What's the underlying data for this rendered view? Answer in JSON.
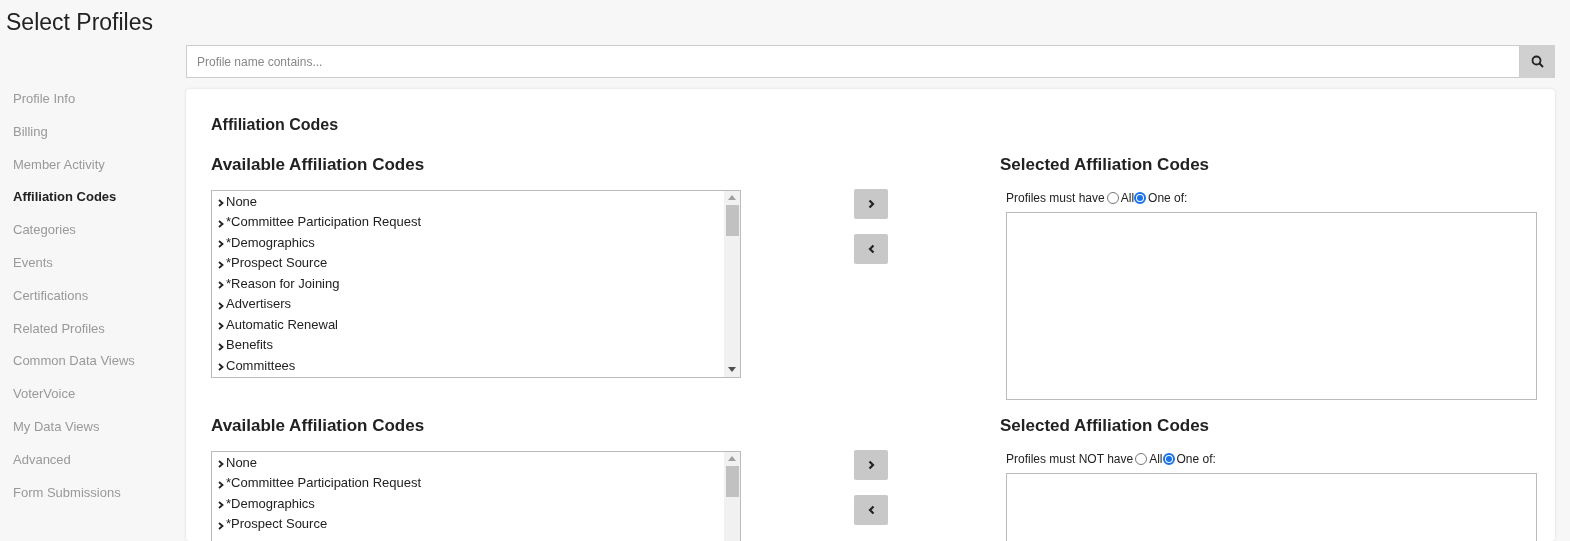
{
  "page_title": "Select Profiles",
  "search": {
    "placeholder": "Profile name contains..."
  },
  "sidebar": {
    "items": [
      {
        "label": "Profile Info",
        "selected": false
      },
      {
        "label": "Billing",
        "selected": false
      },
      {
        "label": "Member Activity",
        "selected": false
      },
      {
        "label": "Affiliation Codes",
        "selected": true
      },
      {
        "label": "Categories",
        "selected": false
      },
      {
        "label": "Events",
        "selected": false
      },
      {
        "label": "Certifications",
        "selected": false
      },
      {
        "label": "Related Profiles",
        "selected": false
      },
      {
        "label": "Common Data Views",
        "selected": false
      },
      {
        "label": "VoterVoice",
        "selected": false
      },
      {
        "label": "My Data Views",
        "selected": false
      },
      {
        "label": "Advanced",
        "selected": false
      },
      {
        "label": "Form Submissions",
        "selected": false
      }
    ]
  },
  "card": {
    "title": "Affiliation Codes",
    "sections": [
      {
        "available_heading": "Available Affiliation Codes",
        "available_items": [
          "None",
          "*Committee Participation Request",
          "*Demographics",
          "*Prospect Source",
          "*Reason for Joining",
          "Advertisers",
          "Automatic Renewal",
          "Benefits",
          "Committees"
        ],
        "selected_heading": "Selected Affiliation Codes",
        "rule_label": "Profiles must have",
        "options": [
          {
            "label": "All",
            "selected": false
          },
          {
            "label": "One of:",
            "selected": true
          }
        ]
      },
      {
        "available_heading": "Available Affiliation Codes",
        "available_items": [
          "None",
          "*Committee Participation Request",
          "*Demographics",
          "*Prospect Source"
        ],
        "selected_heading": "Selected Affiliation Codes",
        "rule_label": "Profiles must NOT have",
        "options": [
          {
            "label": "All",
            "selected": false
          },
          {
            "label": "One of:",
            "selected": true
          }
        ]
      }
    ]
  }
}
